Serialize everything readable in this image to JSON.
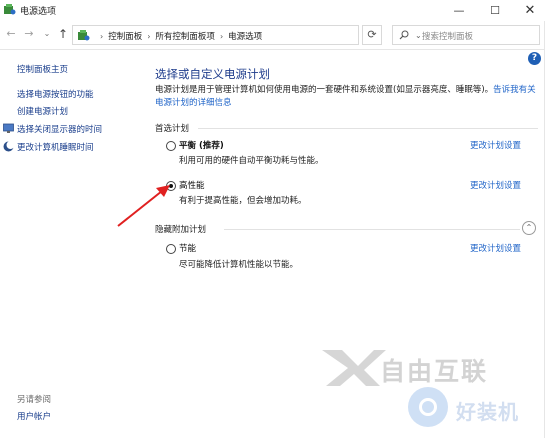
{
  "window": {
    "title": "电源选项",
    "minimize_glyph": "—",
    "maximize_glyph": "☐",
    "close_glyph": "✕"
  },
  "address_bar": {
    "breadcrumbs": [
      "控制面板",
      "所有控制面板项",
      "电源选项"
    ],
    "search_placeholder": "搜索控制面板",
    "refresh_glyph": "⟳"
  },
  "help_glyph": "?",
  "sidebar": {
    "home": "控制面板主页",
    "items": [
      {
        "label": "选择电源按钮的功能",
        "icon": null
      },
      {
        "label": "创建电源计划",
        "icon": null
      },
      {
        "label": "选择关闭显示器的时间",
        "icon": "display-icon"
      },
      {
        "label": "更改计算机睡眠时间",
        "icon": "moon-icon"
      }
    ],
    "see_also_title": "另请参阅",
    "see_also_items": [
      "用户帐户"
    ]
  },
  "main": {
    "title": "选择或自定义电源计划",
    "description": "电源计划是用于管理计算机如何使用电源的一套硬件和系统设置(如显示器亮度、睡眠等)。",
    "description_link": "告诉我有关电源计划的详细信息",
    "preferred_group": "首选计划",
    "hidden_group": "隐藏附加计划",
    "change_link": "更改计划设置",
    "plans": [
      {
        "name": "平衡 (推荐)",
        "description": "利用可用的硬件自动平衡功耗与性能。",
        "selected": false
      },
      {
        "name": "高性能",
        "description": "有利于提高性能，但会增加功耗。",
        "selected": true
      },
      {
        "name": "节能",
        "description": "尽可能降低计算机性能以节能。",
        "selected": false
      }
    ]
  },
  "watermarks": {
    "brand1": "自由互联",
    "brand2": "好装机"
  },
  "colors": {
    "link": "#1f64c8",
    "title_blue": "#1e3c8c",
    "arrow_red": "#e02020"
  }
}
